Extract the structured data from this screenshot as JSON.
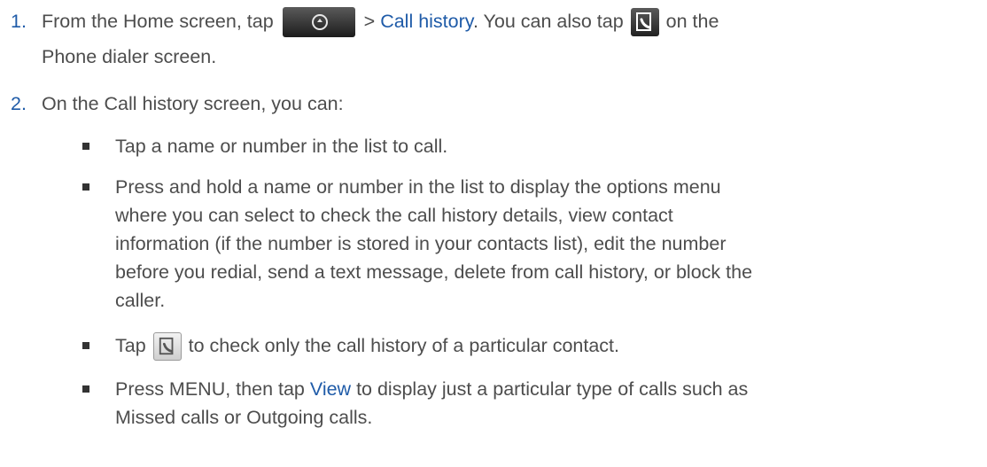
{
  "steps": [
    {
      "number": "1.",
      "line1_a": "From the Home screen, tap",
      "line1_b": " > ",
      "line1_link": "Call history",
      "line1_c": ". You can also tap",
      "line1_d": " on the",
      "line2": "Phone dialer screen."
    },
    {
      "number": "2.",
      "text": "On the Call history screen, you can:"
    }
  ],
  "bullets": {
    "b1": "Tap a name or number in the list to call.",
    "b2_lines": [
      "Press and hold a name or number in the list to display the options menu",
      "where you can select to check the call history details, view contact",
      "information (if the number is stored in your contacts list), edit the number",
      "before you redial, send a text message, delete from call history, or block the",
      "caller."
    ],
    "b3_a": "Tap",
    "b3_b": " to check only the call history of a particular contact.",
    "b4_a": "Press MENU, then tap ",
    "b4_link": "View",
    "b4_b": " to display just a particular type of calls such as",
    "b4_line2": "Missed calls or Outgoing calls."
  },
  "icons": {
    "home_button": "all-apps-icon",
    "call_history": "call-history-icon"
  }
}
